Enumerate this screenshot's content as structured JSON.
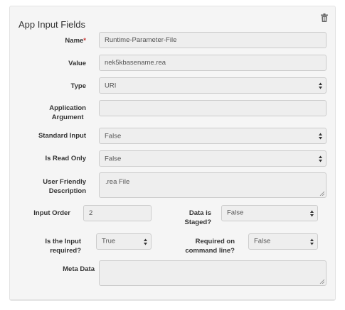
{
  "panel": {
    "title": "App Input Fields",
    "delete_icon": "trash-icon"
  },
  "fields": {
    "name": {
      "label": "Name",
      "required_mark": "*",
      "value": "Runtime-Parameter-File"
    },
    "value": {
      "label": "Value",
      "value": "nek5kbasename.rea"
    },
    "type": {
      "label": "Type",
      "selected": "URI"
    },
    "application_argument": {
      "label_line1": "Application",
      "label_line2": "Argument",
      "value": ""
    },
    "standard_input": {
      "label": "Standard Input",
      "selected": "False"
    },
    "is_read_only": {
      "label": "Is Read Only",
      "selected": "False"
    },
    "user_friendly_description": {
      "label_line1": "User Friendly",
      "label_line2": "Description",
      "value": ".rea File"
    },
    "input_order": {
      "label": "Input Order",
      "value": "2"
    },
    "data_is_staged": {
      "label_line1": "Data is",
      "label_line2": "Staged?",
      "selected": "False"
    },
    "is_input_required": {
      "label_line1": "Is the Input",
      "label_line2": "required?",
      "selected": "True"
    },
    "required_on_command_line": {
      "label_line1": "Required on",
      "label_line2": "command line?",
      "selected": "False"
    },
    "meta_data": {
      "label": "Meta Data",
      "value": ""
    }
  }
}
